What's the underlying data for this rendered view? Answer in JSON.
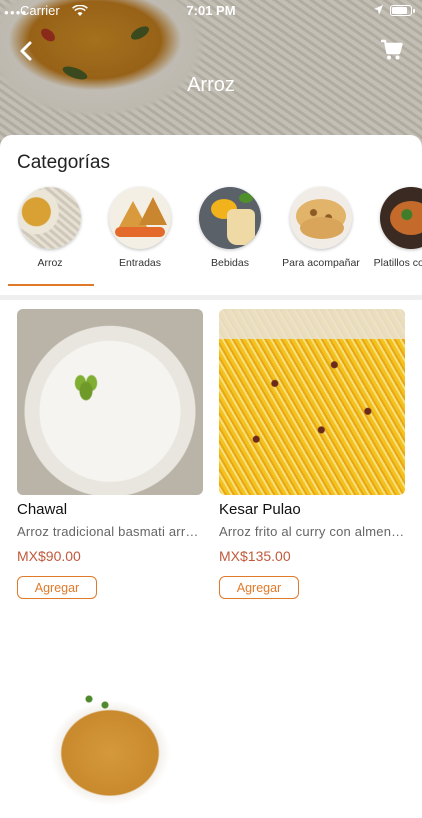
{
  "status_bar": {
    "carrier": "Carrier",
    "time": "7:01 PM",
    "battery_level": 0.9
  },
  "header": {
    "title": "Arroz"
  },
  "categories_title": "Categorías",
  "categories": [
    {
      "label": "Arroz",
      "selected": true
    },
    {
      "label": "Entradas",
      "selected": false
    },
    {
      "label": "Bebidas",
      "selected": false
    },
    {
      "label": "Para acompañar",
      "selected": false
    },
    {
      "label": "Platillos cordero",
      "selected": false
    }
  ],
  "products": [
    {
      "name": "Chawal",
      "description": "Arroz tradicional basmati arroz blanco",
      "price": "MX$90.00",
      "button": "Agregar"
    },
    {
      "name": "Kesar Pulao",
      "description": "Arroz frito al curry con almendras",
      "price": "MX$135.00",
      "button": "Agregar"
    },
    {
      "name": "",
      "description": "",
      "price": "",
      "button": ""
    }
  ],
  "colors": {
    "accent": "#e07a2b",
    "price": "#c05a3b"
  }
}
